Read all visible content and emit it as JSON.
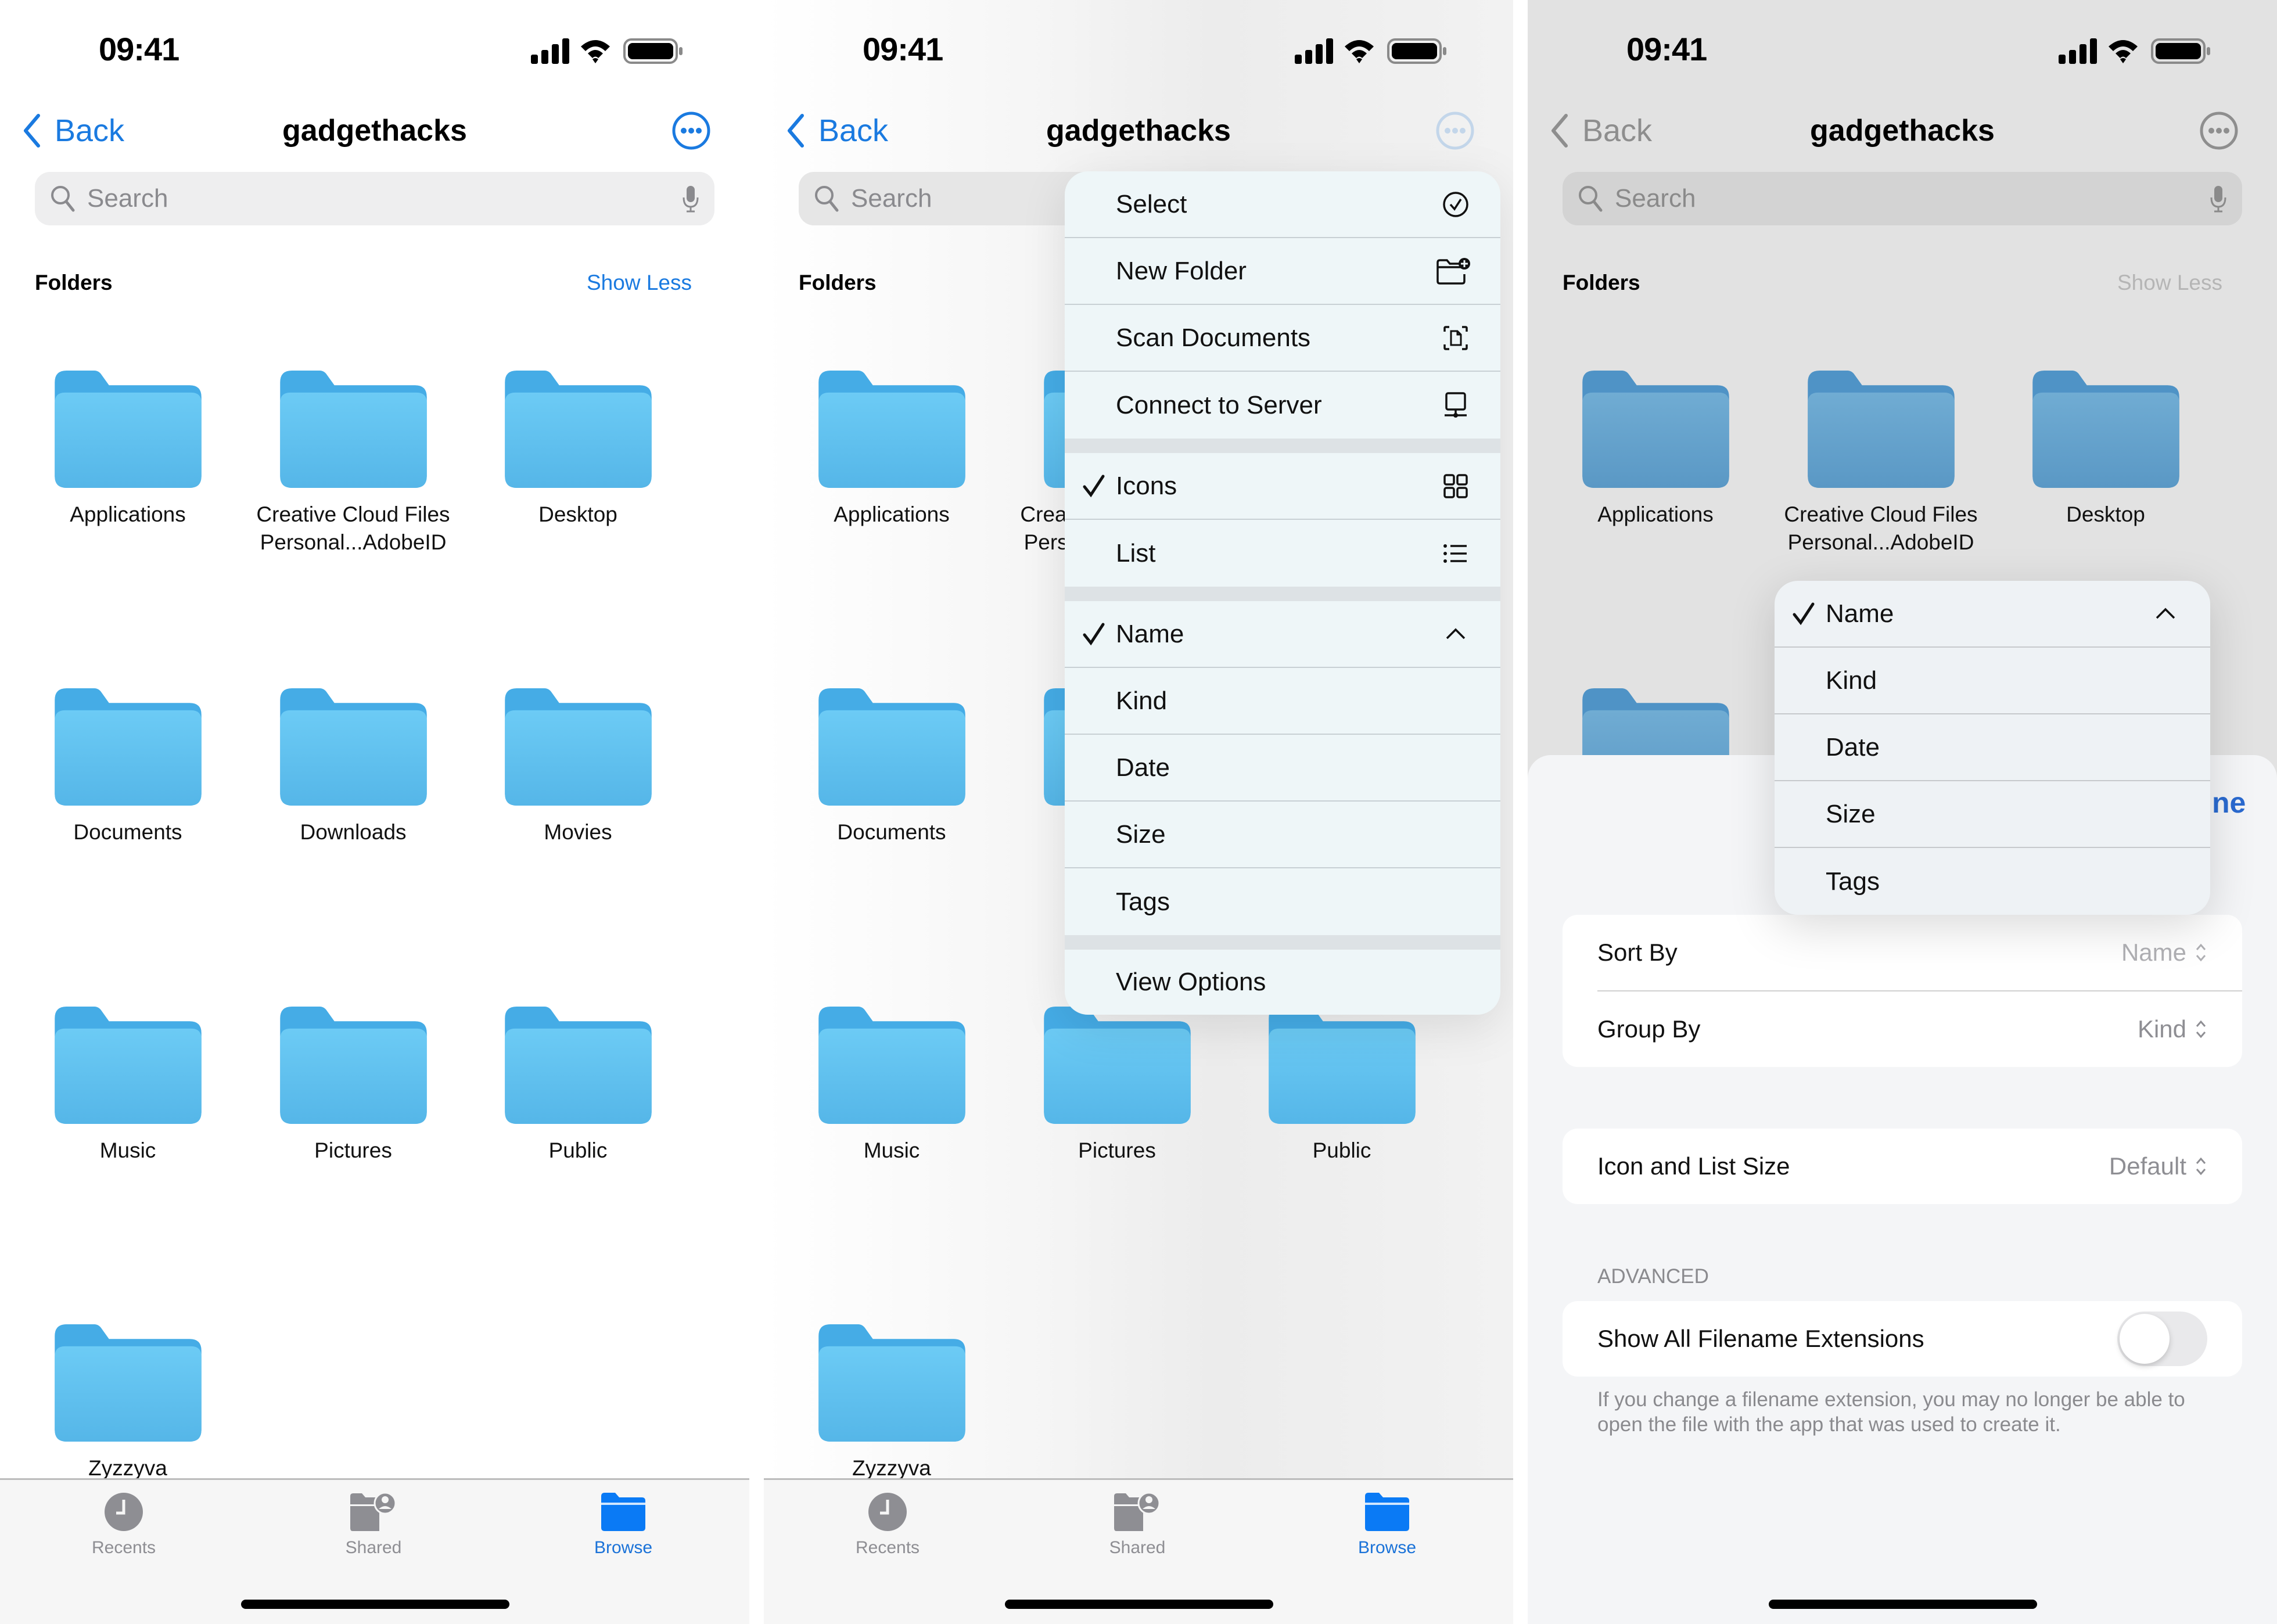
{
  "status_bar": {
    "time": "09:41",
    "icons": [
      "cellular-signal-icon",
      "wifi-icon",
      "battery-icon"
    ]
  },
  "nav": {
    "back_label": "Back",
    "title": "gadgethacks",
    "more_icon": "ellipsis-circle-icon"
  },
  "search": {
    "placeholder": "Search",
    "icon": "magnifying-glass-icon",
    "mic_icon": "microphone-icon"
  },
  "section": {
    "title": "Folders",
    "toggle_label": "Show Less"
  },
  "folders": [
    {
      "name": "Applications"
    },
    {
      "name": "Creative Cloud Files Personal...AdobeID",
      "line1": "Creative Cloud Files",
      "line2": "Personal...AdobeID"
    },
    {
      "name": "Desktop"
    },
    {
      "name": "Documents"
    },
    {
      "name": "Downloads"
    },
    {
      "name": "Movies"
    },
    {
      "name": "Music"
    },
    {
      "name": "Pictures"
    },
    {
      "name": "Public"
    },
    {
      "name": "Zyzzyva"
    }
  ],
  "tabs": [
    {
      "label": "Recents",
      "icon": "clock-icon",
      "active": false
    },
    {
      "label": "Shared",
      "icon": "shared-folder-icon",
      "active": false
    },
    {
      "label": "Browse",
      "icon": "folder-icon",
      "active": true
    }
  ],
  "colors": {
    "accent": "#1a7ae0",
    "folder": "#62c2f0",
    "folder_tab": "#45ace6",
    "menu_bg": "#eef6f8"
  },
  "more_menu": {
    "actions": [
      {
        "label": "Select",
        "icon": "checkmark-circle-icon"
      },
      {
        "label": "New Folder",
        "icon": "folder-badge-plus-icon"
      },
      {
        "label": "Scan Documents",
        "icon": "doc-viewfinder-icon"
      },
      {
        "label": "Connect to Server",
        "icon": "desktop-network-icon"
      }
    ],
    "view_modes": [
      {
        "label": "Icons",
        "icon": "grid-icon",
        "checked": true
      },
      {
        "label": "List",
        "icon": "list-bullet-icon",
        "checked": false
      }
    ],
    "sort": [
      {
        "label": "Name",
        "checked": true,
        "direction_icon": "chevron-up-icon"
      },
      {
        "label": "Kind",
        "checked": false
      },
      {
        "label": "Date",
        "checked": false
      },
      {
        "label": "Size",
        "checked": false
      },
      {
        "label": "Tags",
        "checked": false
      }
    ],
    "view_options_label": "View Options"
  },
  "view_options": {
    "done_fragment": "ne",
    "sort_dropdown": [
      {
        "label": "Name",
        "checked": true
      },
      {
        "label": "Kind",
        "checked": false
      },
      {
        "label": "Date",
        "checked": false
      },
      {
        "label": "Size",
        "checked": false
      },
      {
        "label": "Tags",
        "checked": false
      }
    ],
    "sort_by": {
      "label": "Sort By",
      "value": "Name"
    },
    "group_by": {
      "label": "Group By",
      "value": "Kind"
    },
    "icon_size": {
      "label": "Icon and List Size",
      "value": "Default"
    },
    "advanced_header": "ADVANCED",
    "show_extensions": {
      "label": "Show All Filename Extensions",
      "enabled": false
    },
    "footnote": "If you change a filename extension, you may no longer be able to open the file with the app that was used to create it."
  }
}
